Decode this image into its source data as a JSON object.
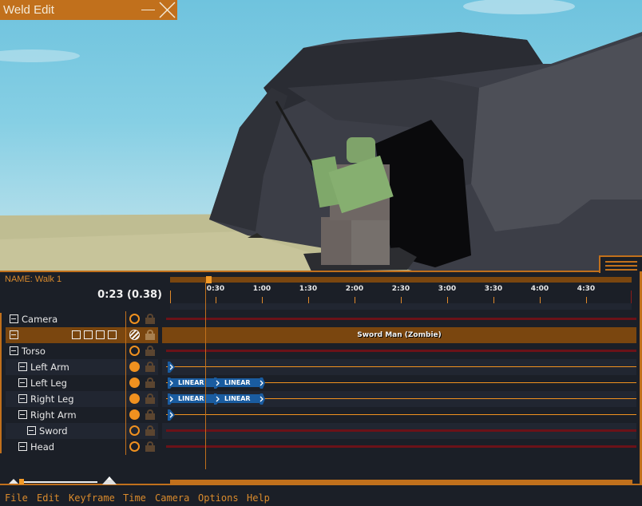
{
  "window": {
    "title": "Weld Edit",
    "minimize_icon": "minimize-icon",
    "close_icon": "close-x-icon"
  },
  "colors": {
    "accent": "#c1701c",
    "accent_bright": "#f0911f",
    "selected_row": "#7a460f",
    "panel_bg": "#1b1f27",
    "alt_row": "#212631",
    "keyframe_blue": "#1a5ca0",
    "inactive_track": "#6b1218"
  },
  "editor": {
    "name_label": "NAME: Walk 1",
    "time_readout": "0:23 (0.38)",
    "playhead_fraction": 0.077,
    "ruler_labels": [
      "0:30",
      "1:00",
      "1:30",
      "2:00",
      "2:30",
      "3:00",
      "3:30",
      "4:00",
      "4:30"
    ]
  },
  "tracks": [
    {
      "label": "Camera",
      "indent": 0,
      "keyframe": "empty",
      "lane": "inactive"
    },
    {
      "label": "",
      "indent": 0,
      "keyframe": "hatched",
      "lane": "group",
      "group_label": "Sword Man (Zombie)",
      "selected": true,
      "tools": [
        "insert-keyframe-icon",
        "columns-icon",
        "diamond-target-icon",
        "clipboard-icon"
      ]
    },
    {
      "label": "Torso",
      "indent": 0,
      "keyframe": "empty",
      "lane": "inactive"
    },
    {
      "label": "Left Arm",
      "indent": 1,
      "keyframe": "filled",
      "lane": "active",
      "blocks": []
    },
    {
      "label": "Left Leg",
      "indent": 1,
      "keyframe": "filled",
      "lane": "active",
      "blocks": [
        "LINEAR",
        "LINEAR"
      ]
    },
    {
      "label": "Right Leg",
      "indent": 1,
      "keyframe": "filled",
      "lane": "active",
      "blocks": [
        "LINEAR",
        "LINEAR"
      ]
    },
    {
      "label": "Right Arm",
      "indent": 1,
      "keyframe": "filled",
      "lane": "active",
      "blocks": []
    },
    {
      "label": "Sword",
      "indent": 2,
      "keyframe": "empty",
      "lane": "inactive"
    },
    {
      "label": "Head",
      "indent": 1,
      "keyframe": "empty",
      "lane": "inactive"
    }
  ],
  "bottom": {
    "zoom_slider_value": 0.0,
    "zoom_out_icon": "small-mountain-icon",
    "zoom_in_icon": "large-mountain-icon"
  },
  "menu": [
    "File",
    "Edit",
    "Keyframe",
    "Time",
    "Camera",
    "Options",
    "Help"
  ]
}
